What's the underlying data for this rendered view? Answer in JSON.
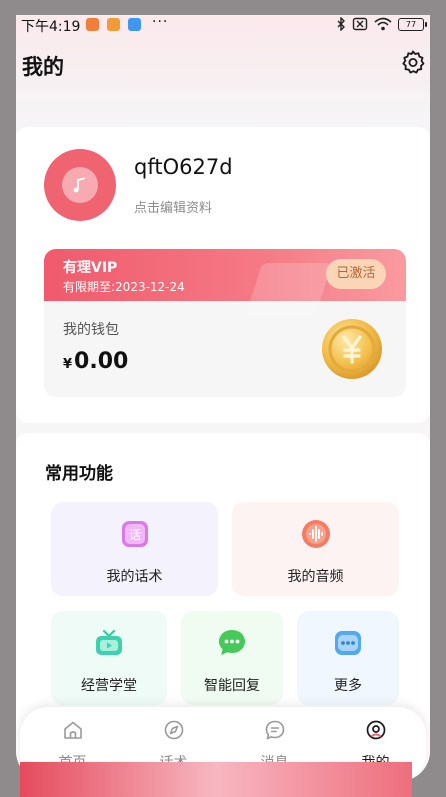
{
  "status_bar": {
    "time": "下午4:19",
    "dots": "···",
    "battery": "77",
    "icons": [
      "app-icon-orange",
      "app-icon-taobao",
      "app-icon-blue",
      "bluetooth-icon",
      "no-sim-icon",
      "wifi-icon",
      "battery-icon"
    ]
  },
  "header": {
    "title": "我的",
    "settings_icon": "gear-icon"
  },
  "profile": {
    "username": "qftO627d",
    "edit_hint": "点击编辑资料",
    "avatar_icon": "music-note-icon"
  },
  "vip": {
    "title": "有理VIP",
    "expire": "有限期至:2023-12-24",
    "status": "已激活"
  },
  "wallet": {
    "label": "我的钱包",
    "currency": "¥",
    "amount": "0.00",
    "icon": "yuan-coin-icon"
  },
  "functions": {
    "title": "常用功能",
    "items": [
      {
        "label": "我的话术",
        "icon": "script-icon",
        "bg": "#f3f2fd"
      },
      {
        "label": "我的音频",
        "icon": "audio-wave-icon",
        "bg": "#fdf3f3"
      },
      {
        "label": "经营学堂",
        "icon": "tv-icon",
        "bg": "#effbf6"
      },
      {
        "label": "智能回复",
        "icon": "chat-bubble-icon",
        "bg": "#f0fbf1"
      },
      {
        "label": "更多",
        "icon": "more-icon",
        "bg": "#f1f7fe"
      }
    ]
  },
  "nav": {
    "items": [
      {
        "label": "首页",
        "icon": "home-icon"
      },
      {
        "label": "话术",
        "icon": "compass-icon"
      },
      {
        "label": "消息",
        "icon": "message-icon"
      },
      {
        "label": "我的",
        "icon": "profile-icon",
        "active": true
      }
    ]
  },
  "colors": {
    "accent": "#f06472",
    "vip_badge": "#fbd5b7",
    "page_bg": "#f6f6f7"
  }
}
